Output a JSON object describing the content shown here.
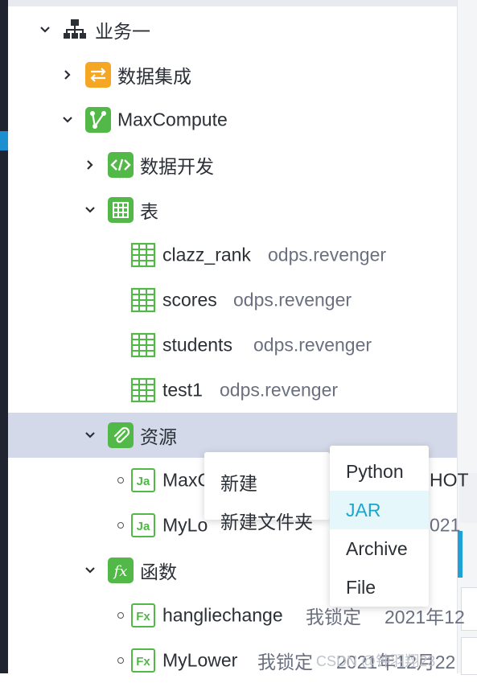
{
  "tree": {
    "business": {
      "label": "业务一",
      "icon": "org-chart-icon"
    },
    "data_integration": {
      "label": "数据集成",
      "icon_color": "#f5a623"
    },
    "maxcompute": {
      "label": "MaxCompute",
      "icon_color": "#52b847"
    },
    "data_dev": {
      "label": "数据开发",
      "icon_color": "#52b847"
    },
    "tables_folder": {
      "label": "表",
      "icon_color": "#52b847"
    },
    "tables": [
      {
        "name": "clazz_rank",
        "owner": "odps.revenger"
      },
      {
        "name": "scores",
        "owner": "odps.revenger"
      },
      {
        "name": "students",
        "owner": "odps.revenger"
      },
      {
        "name": "test1",
        "owner": "odps.revenger"
      }
    ],
    "resources_folder": {
      "label": "资源",
      "icon_color": "#52b847"
    },
    "resources": [
      {
        "badge": "Ja",
        "name": "MaxC",
        "tail": "HOT"
      },
      {
        "badge": "Ja",
        "name": "MyLo",
        "tail": "021"
      }
    ],
    "functions_folder": {
      "label": "函数",
      "badge": "fx",
      "icon_color": "#52b847"
    },
    "functions": [
      {
        "badge": "Fx",
        "name": "hangliechange",
        "lock": "我锁定",
        "date": "2021年12"
      },
      {
        "badge": "Fx",
        "name": "MyLower",
        "lock": "我锁定",
        "date": "2021年12月22"
      }
    ]
  },
  "context_menu": {
    "items": [
      "新建",
      "新建文件夹"
    ]
  },
  "submenu": {
    "items": [
      "Python",
      "JAR",
      "Archive",
      "File"
    ],
    "active": "JAR"
  },
  "watermark": "CSDN @钟羽翔23",
  "colors": {
    "selected_row": "#d3d9e8",
    "accent": "#1fa5c9",
    "green": "#52b847",
    "orange": "#f5a623"
  }
}
